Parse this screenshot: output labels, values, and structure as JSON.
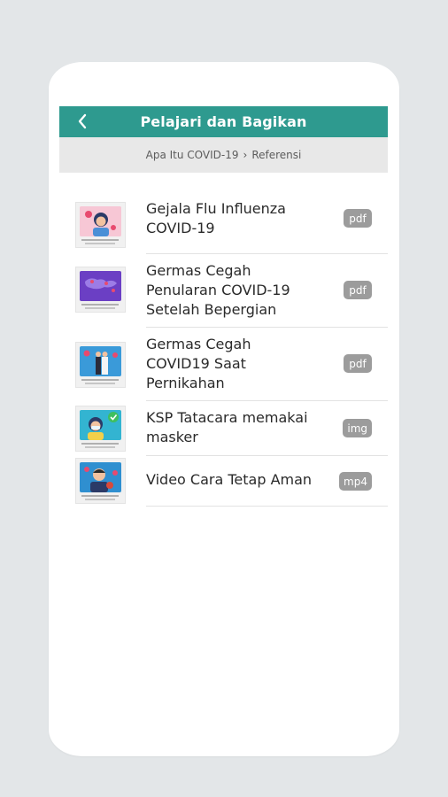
{
  "header": {
    "title": "Pelajari dan Bagikan",
    "back_icon": "chevron-left-icon"
  },
  "breadcrumb": {
    "first": "Apa Itu COVID-19",
    "separator": "›",
    "second": "Referensi"
  },
  "items": [
    {
      "title_lines": [
        "Gejala Flu Influenza",
        "COVID-19"
      ],
      "type": "pdf"
    },
    {
      "title_lines": [
        "Germas Cegah",
        "Penularan COVID-19",
        "Setelah Bepergian"
      ],
      "type": "pdf"
    },
    {
      "title_lines": [
        "Germas Cegah",
        "COVID19 Saat",
        "Pernikahan"
      ],
      "type": "pdf"
    },
    {
      "title_lines": [
        "KSP Tatacara memakai",
        "masker"
      ],
      "type": "img"
    },
    {
      "title_lines": [
        "Video Cara Tetap Aman"
      ],
      "type": "mp4"
    }
  ],
  "colors": {
    "header": "#2e9a8f",
    "badge": "#9c9c9c",
    "background": "#e3e6e8"
  }
}
